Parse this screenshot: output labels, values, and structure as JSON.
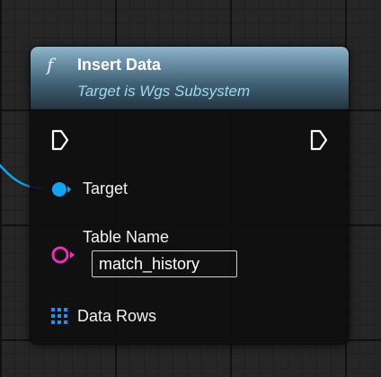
{
  "node": {
    "function_icon": "f",
    "title": "Insert Data",
    "subtitle": "Target is Wgs Subsystem",
    "colors": {
      "header_top": "#8fb5cc",
      "header_bottom": "#243542",
      "subtitle": "#9fd8f2",
      "body": "#0e0e0e"
    }
  },
  "pins": {
    "exec_in": {
      "icon": "exec-arrow-icon"
    },
    "exec_out": {
      "icon": "exec-arrow-icon"
    },
    "target": {
      "label": "Target",
      "icon": "object-pin-icon",
      "color": "#0ea5f5"
    },
    "table_name": {
      "label": "Table Name",
      "value": "match_history",
      "icon": "string-pin-icon",
      "color": "#e92fb8"
    },
    "data_rows": {
      "label": "Data Rows",
      "icon": "array-grid-icon",
      "color": "#1f8ef5"
    }
  },
  "canvas": {
    "background": "#262626",
    "grid_minor": "#202020",
    "grid_major": "#111111",
    "wire_color": "#0ea5f5"
  }
}
